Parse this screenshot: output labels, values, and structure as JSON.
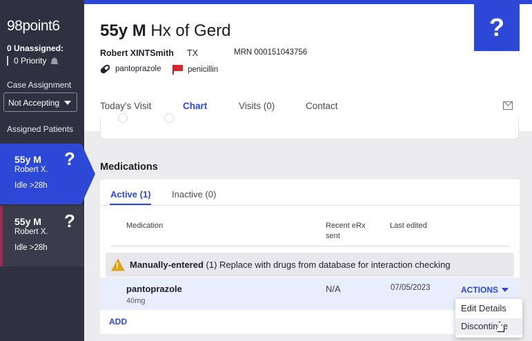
{
  "sidebar": {
    "logo": "98point6",
    "unassigned": "0 Unassigned:",
    "priority": "0 Priority",
    "case_assignment_label": "Case Assignment",
    "case_assignment_value": "Not Accepting",
    "assigned_patients_label": "Assigned Patients",
    "patients": [
      {
        "age_sex": "55y M",
        "name": "Robert X.",
        "status": "Idle >28h",
        "badge": "?"
      },
      {
        "age_sex": "55y M",
        "name": "Robert X.",
        "status": "Idle >28h",
        "badge": "?"
      }
    ]
  },
  "header": {
    "title_bold": "55y M",
    "title_rest": " Hx of Gerd",
    "patient_name": "Robert XINTSmith",
    "state": "TX",
    "mrn": "MRN 000151043756",
    "medication_tag": "pantoprazole",
    "allergy_tag": "penicillin",
    "badge": "?",
    "tabs": [
      "Today's Visit",
      "Chart",
      "Visits (0)",
      "Contact"
    ],
    "active_tab": "Chart"
  },
  "medications": {
    "section_title": "Medications",
    "tabs": [
      "Active (1)",
      "Inactive (0)"
    ],
    "columns": [
      "Medication",
      "Recent eRx sent",
      "Last edited"
    ],
    "warning_bold": "Manually-entered",
    "warning_rest": " (1) Replace with drugs from database for interaction checking",
    "rows": [
      {
        "name": "pantoprazole",
        "dose": "40mg",
        "erx": "N/A",
        "last_edited": "07/05/2023",
        "actions": "ACTIONS"
      }
    ],
    "add_label": "ADD"
  },
  "actions_menu": {
    "items": [
      "Edit Details",
      "Discontinue"
    ]
  },
  "colors": {
    "brand_blue": "#2d47d6",
    "sidebar": "#2f3140",
    "warning": "#e0a418",
    "allergy_flag": "#d9262d"
  }
}
